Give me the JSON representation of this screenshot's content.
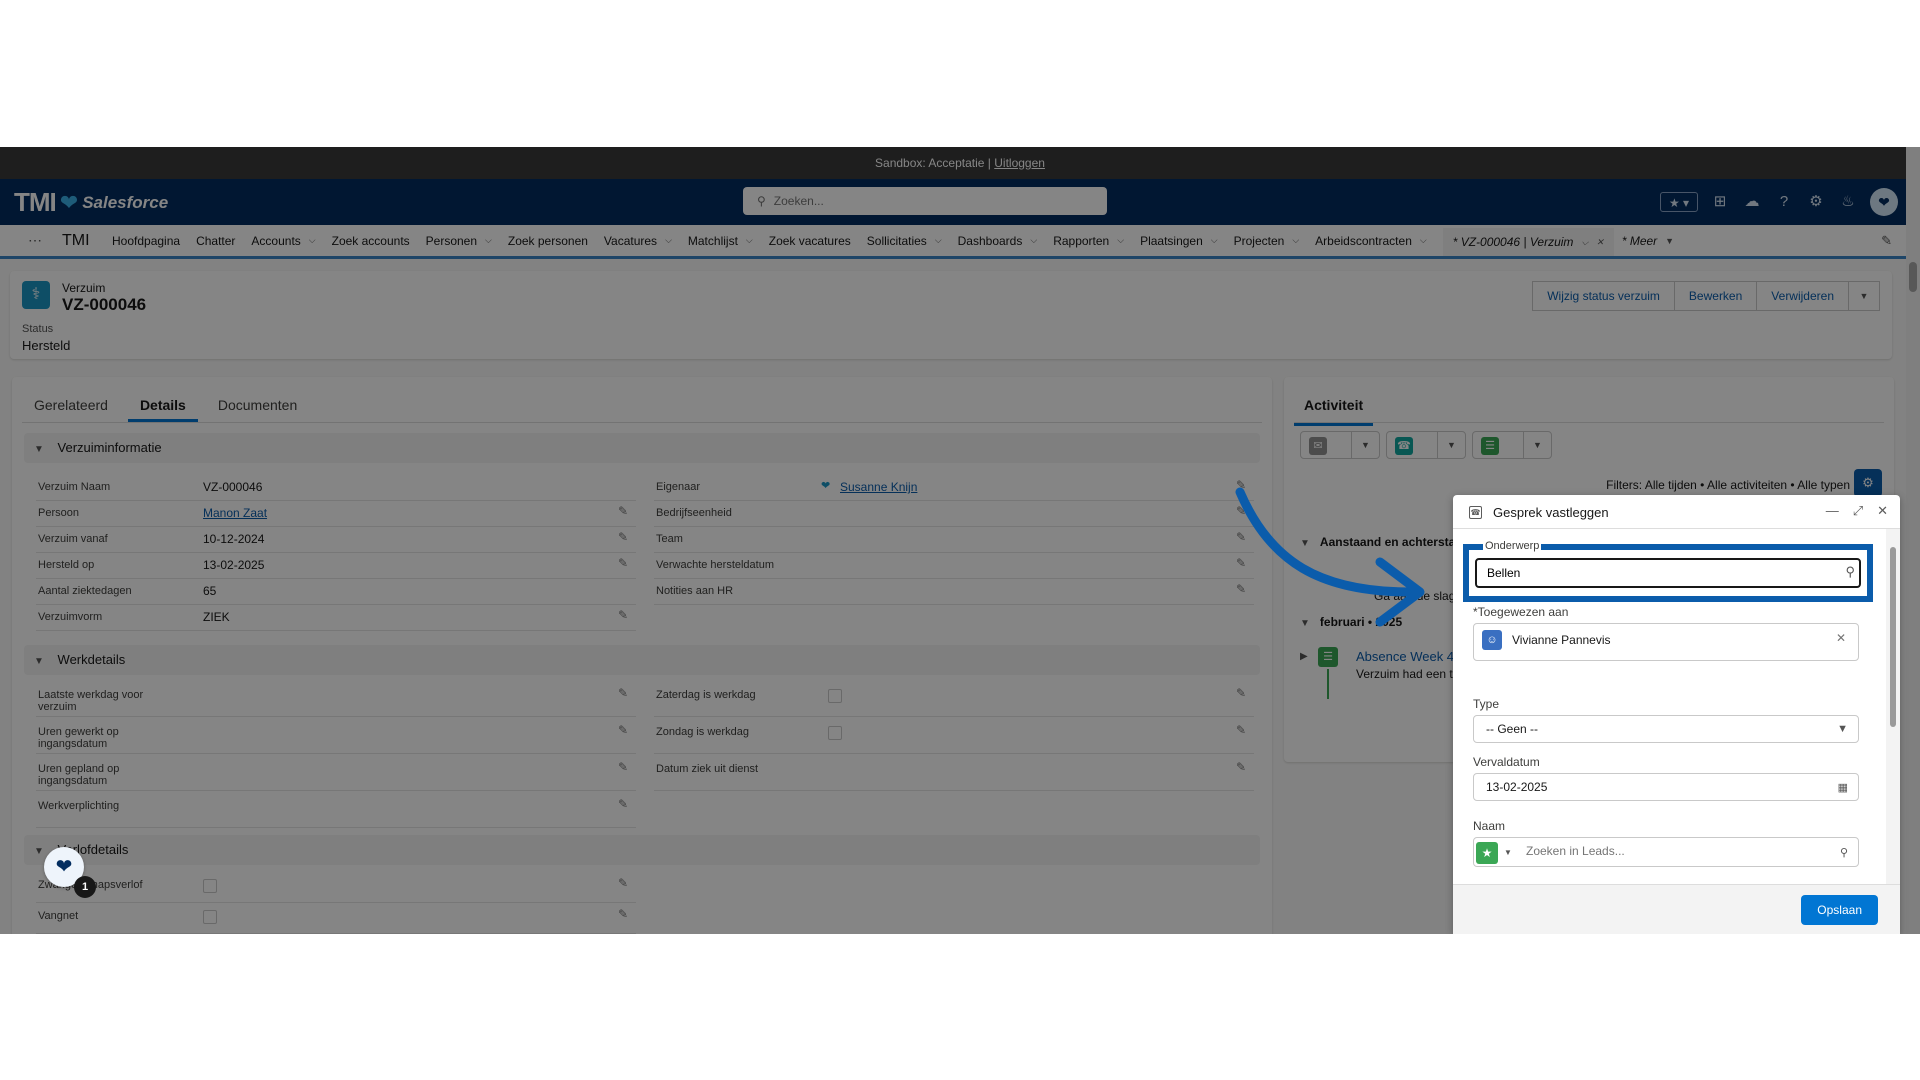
{
  "sandbox": {
    "text": "Sandbox: Acceptatie |",
    "logout": "Uitloggen"
  },
  "header": {
    "logo_tmi": "TMI",
    "logo_salesforce": "Salesforce",
    "search_placeholder": "Zoeken..."
  },
  "nav": {
    "app_name": "TMI",
    "items": [
      {
        "label": "Hoofdpagina",
        "chevron": false
      },
      {
        "label": "Chatter",
        "chevron": false
      },
      {
        "label": "Accounts",
        "chevron": true
      },
      {
        "label": "Zoek accounts",
        "chevron": false
      },
      {
        "label": "Personen",
        "chevron": true
      },
      {
        "label": "Zoek personen",
        "chevron": false
      },
      {
        "label": "Vacatures",
        "chevron": true
      },
      {
        "label": "Matchlijst",
        "chevron": true
      },
      {
        "label": "Zoek vacatures",
        "chevron": false
      },
      {
        "label": "Sollicitaties",
        "chevron": true
      },
      {
        "label": "Dashboards",
        "chevron": true
      },
      {
        "label": "Rapporten",
        "chevron": true
      },
      {
        "label": "Plaatsingen",
        "chevron": true
      },
      {
        "label": "Projecten",
        "chevron": true
      },
      {
        "label": "Arbeidscontracten",
        "chevron": true
      }
    ],
    "active_tab": "* VZ-000046 | Verzuim",
    "more": "* Meer"
  },
  "record": {
    "type": "Verzuim",
    "name": "VZ-000046",
    "status_label": "Status",
    "status_value": "Hersteld",
    "buttons": [
      "Wijzig status verzuim",
      "Bewerken",
      "Verwijderen"
    ]
  },
  "tabs": [
    "Gerelateerd",
    "Details",
    "Documenten"
  ],
  "sections": {
    "verzuiminformatie": "Verzuiminformatie",
    "werkdetails": "Werkdetails",
    "third": "Verlofdetails"
  },
  "left_fields": [
    {
      "label": "Verzuim Naam",
      "value": "VZ-000046",
      "link": false,
      "edit": false
    },
    {
      "label": "Persoon",
      "value": "Manon Zaat",
      "link": true,
      "edit": true
    },
    {
      "label": "Verzuim vanaf",
      "value": "10-12-2024",
      "link": false,
      "edit": true
    },
    {
      "label": "Hersteld op",
      "value": "13-02-2025",
      "link": false,
      "edit": true
    },
    {
      "label": "Aantal ziektedagen",
      "value": "65",
      "link": false,
      "edit": false
    },
    {
      "label": "Verzuimvorm",
      "value": "ZIEK",
      "link": false,
      "edit": true
    }
  ],
  "right_fields": [
    {
      "label": "Eigenaar",
      "value": "Susanne Knijn",
      "link": true
    },
    {
      "label": "Bedrijfseenheid",
      "value": ""
    },
    {
      "label": "Team",
      "value": ""
    },
    {
      "label": "Verwachte hersteldatum",
      "value": ""
    },
    {
      "label": "Notities aan HR",
      "value": ""
    }
  ],
  "werk_left": [
    {
      "label": "Laatste werkdag voor verzuim"
    },
    {
      "label": "Uren gewerkt op ingangsdatum"
    },
    {
      "label": "Uren gepland op ingangsdatum"
    },
    {
      "label": "Werkverplichting"
    }
  ],
  "werk_right": [
    {
      "label": "Zaterdag is werkdag"
    },
    {
      "label": "Zondag is werkdag"
    },
    {
      "label": "Datum ziek uit dienst"
    }
  ],
  "third_fields": [
    {
      "label": "Zwangerschapsverlof"
    },
    {
      "label": "Vangnet"
    }
  ],
  "activity": {
    "tab": "Activiteit",
    "filters": "Filters: Alle tijden • Alle activiteiten • Alle typen",
    "upcoming": "Aanstaand en achterstallig",
    "upcoming_sub": "Ga aan de slag",
    "month": "februari • 2025",
    "item_title": "Absence Week 4",
    "item_sub": "Verzuim had een ta"
  },
  "modal": {
    "title": "Gesprek vastleggen",
    "subject_label": "Onderwerp",
    "subject_value": "Bellen",
    "assigned_label": "*Toegewezen aan",
    "assigned_value": "Vivianne Pannevis",
    "type_label": "Type",
    "type_value": "-- Geen --",
    "due_label": "Vervaldatum",
    "due_value": "13-02-2025",
    "name_label": "Naam",
    "name_placeholder": "Zoeken in Leads...",
    "save": "Opslaan"
  },
  "assistant_badge": "1",
  "colors": {
    "header": "#032d60",
    "brand_blue": "#0176d3",
    "highlight": "#0b5cab",
    "task_green": "#3ba755"
  }
}
